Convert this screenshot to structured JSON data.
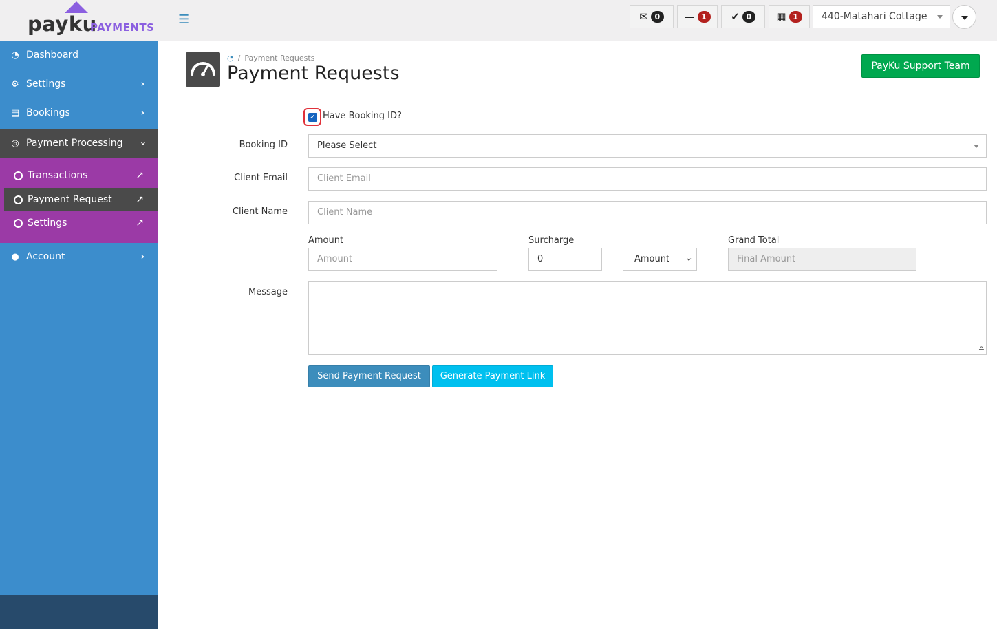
{
  "brand": {
    "name": "payku",
    "sub": "PAYMENTS",
    "accent": "#8b5fe0"
  },
  "topbar": {
    "messages_count": "0",
    "pending_count": "1",
    "done_count": "0",
    "calendar_count": "1",
    "property": "440-Matahari Cottage"
  },
  "sidebar": {
    "items": [
      {
        "label": "Dashboard"
      },
      {
        "label": "Settings"
      },
      {
        "label": "Bookings"
      },
      {
        "label": "Payment Processing"
      },
      {
        "label": "Account"
      }
    ],
    "submenu": [
      {
        "label": "Transactions"
      },
      {
        "label": "Payment Request"
      },
      {
        "label": "Settings"
      }
    ]
  },
  "header": {
    "breadcrumb": "Payment Requests",
    "title": "Payment Requests",
    "support_button": "PayKu Support Team"
  },
  "form": {
    "have_booking_id_label": "Have Booking ID?",
    "have_booking_id_checked": true,
    "booking_id_label": "Booking ID",
    "booking_id_value": "Please Select",
    "client_email_label": "Client Email",
    "client_email_placeholder": "Client Email",
    "client_name_label": "Client Name",
    "client_name_placeholder": "Client Name",
    "amount_label": "Amount",
    "amount_placeholder": "Amount",
    "surcharge_label": "Surcharge",
    "surcharge_value": "0",
    "surcharge_type": "Amount",
    "grand_total_label": "Grand Total",
    "grand_total_placeholder": "Final Amount",
    "message_label": "Message",
    "send_button": "Send Payment Request",
    "link_button": "Generate Payment Link"
  },
  "colors": {
    "sidebar": "#3c8dcc",
    "submenu": "#9b3aa6",
    "support": "#00a84f",
    "send": "#3c8dbc",
    "link": "#00c0ef"
  }
}
